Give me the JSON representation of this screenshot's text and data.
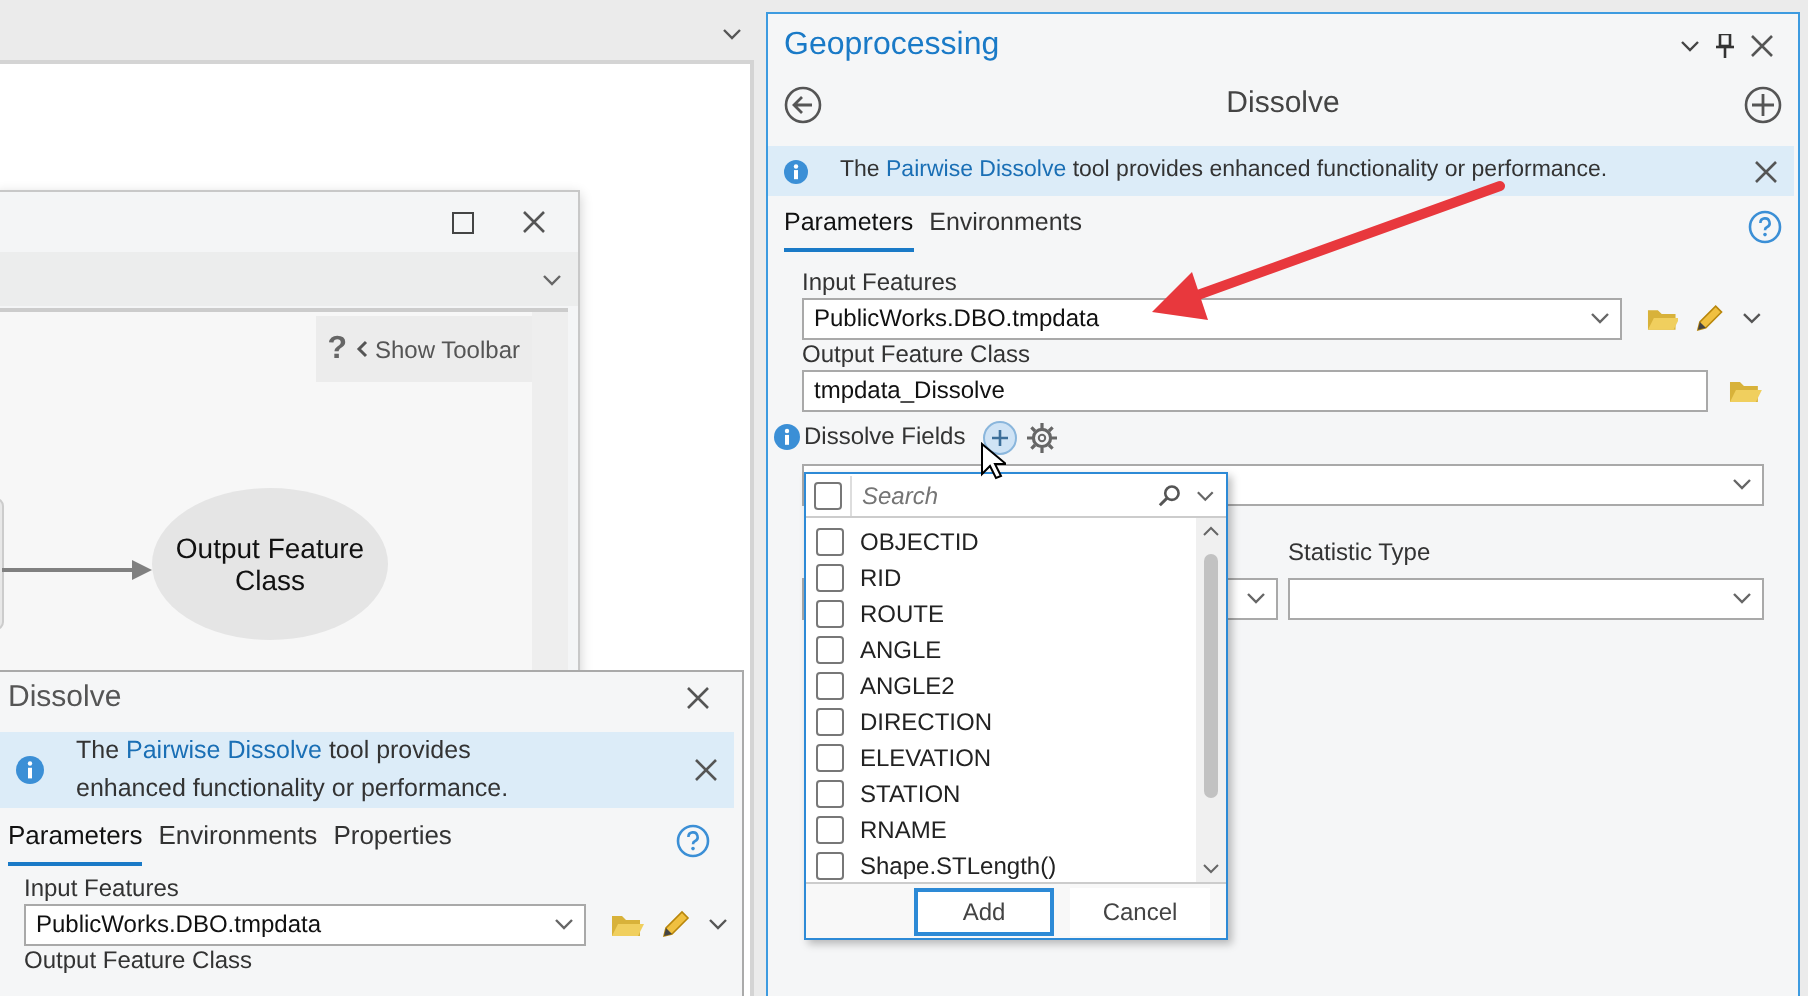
{
  "model_window": {
    "show_toolbar": {
      "help": "?",
      "label": "Show Toolbar"
    },
    "nodes": [
      {
        "label": "Output Feature Class"
      }
    ]
  },
  "tool_dialog": {
    "title": "Dissolve",
    "info": {
      "before": "The ",
      "link": "Pairwise Dissolve",
      "after": " tool provides enhanced functionality or performance."
    },
    "tabs": [
      {
        "label": "Parameters",
        "selected": true
      },
      {
        "label": "Environments",
        "selected": false
      },
      {
        "label": "Properties",
        "selected": false
      }
    ],
    "input_features": {
      "label": "Input Features",
      "value": "PublicWorks.DBO.tmpdata"
    },
    "output_feature_class": {
      "label": "Output Feature Class"
    }
  },
  "geoprocessing": {
    "title": "Geoprocessing",
    "tool": "Dissolve",
    "info": {
      "before": "The ",
      "link": "Pairwise Dissolve",
      "after": " tool provides enhanced functionality or performance."
    },
    "tabs": [
      {
        "label": "Parameters",
        "selected": true
      },
      {
        "label": "Environments",
        "selected": false
      }
    ],
    "input_features": {
      "label": "Input Features",
      "value": "PublicWorks.DBO.tmpdata"
    },
    "output_feature_class": {
      "label": "Output Feature Class",
      "value": "tmpdata_Dissolve"
    },
    "dissolve_fields": {
      "label": "Dissolve Fields"
    },
    "statistic_type": {
      "label": "Statistic Type"
    },
    "field_picker": {
      "search": {
        "placeholder": "Search"
      },
      "select_all_checked": false,
      "fields": [
        {
          "name": "OBJECTID",
          "checked": false
        },
        {
          "name": "RID",
          "checked": false
        },
        {
          "name": "ROUTE",
          "checked": false
        },
        {
          "name": "ANGLE",
          "checked": false
        },
        {
          "name": "ANGLE2",
          "checked": false
        },
        {
          "name": "DIRECTION",
          "checked": false
        },
        {
          "name": "ELEVATION",
          "checked": false
        },
        {
          "name": "STATION",
          "checked": false
        },
        {
          "name": "RNAME",
          "checked": false
        },
        {
          "name": "Shape.STLength()",
          "checked": false
        }
      ],
      "buttons": [
        {
          "label": "Add",
          "default": true
        },
        {
          "label": "Cancel",
          "default": false
        }
      ]
    }
  }
}
